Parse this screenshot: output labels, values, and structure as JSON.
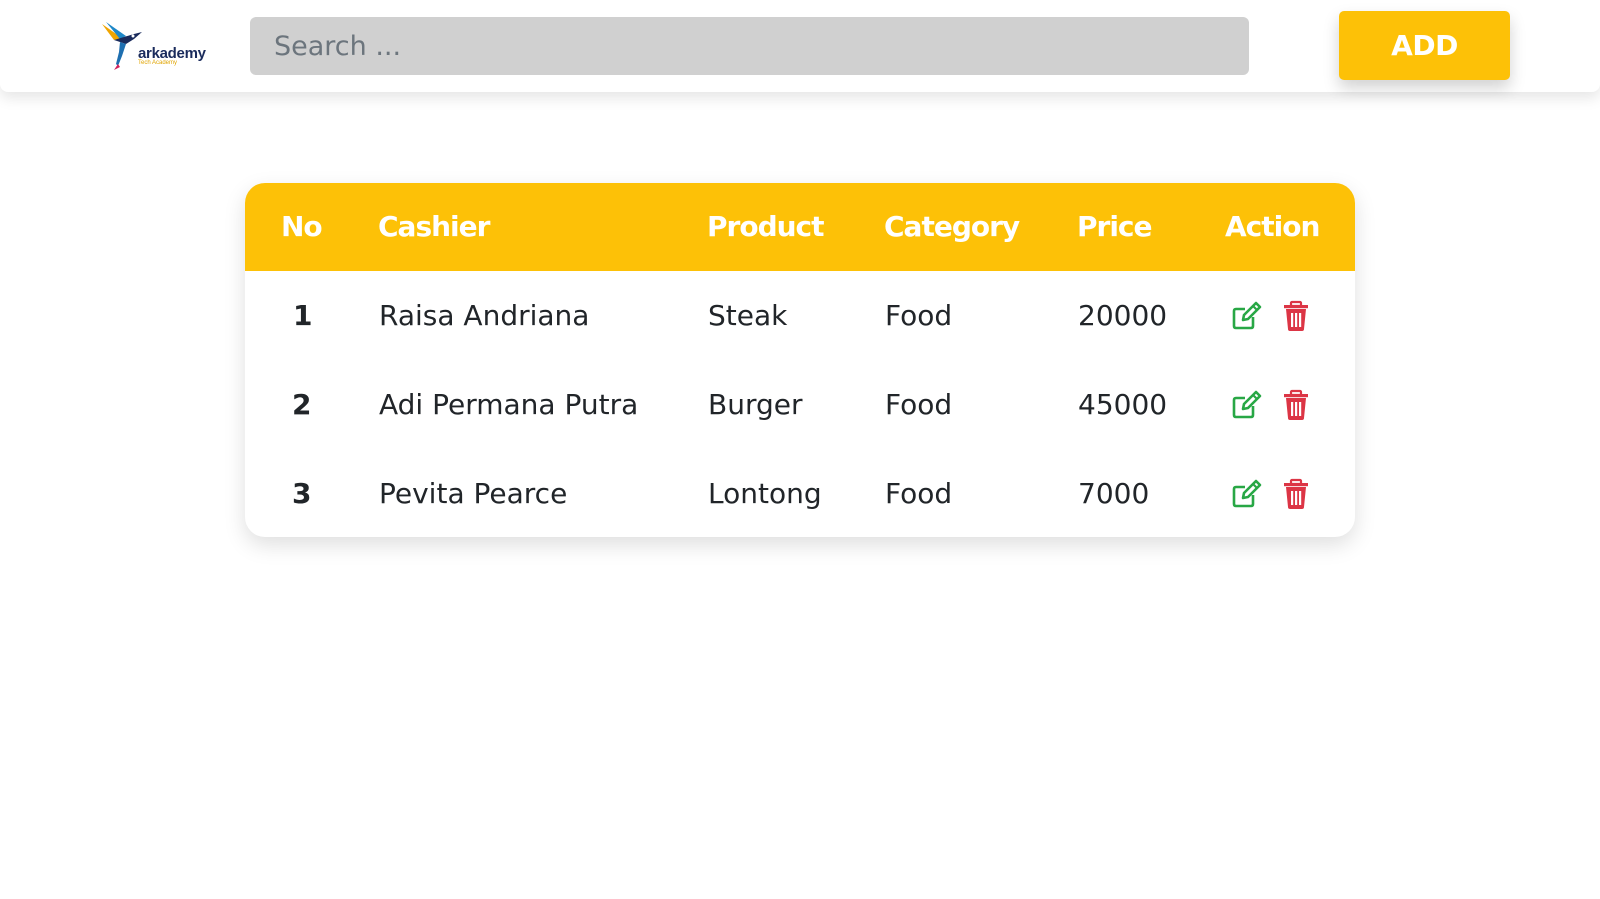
{
  "navbar": {
    "logo": {
      "word": "arkademy",
      "sub": "Tech Academy"
    },
    "search": {
      "placeholder": "Search ...",
      "value": ""
    },
    "add_label": "ADD"
  },
  "table": {
    "headers": [
      "No",
      "Cashier",
      "Product",
      "Category",
      "Price",
      "Action"
    ],
    "rows": [
      {
        "no": "1",
        "cashier": "Raisa Andriana",
        "product": "Steak",
        "category": "Food",
        "price": "20000"
      },
      {
        "no": "2",
        "cashier": "Adi Permana Putra",
        "product": "Burger",
        "category": "Food",
        "price": "45000"
      },
      {
        "no": "3",
        "cashier": "Pevita Pearce",
        "product": "Lontong",
        "category": "Food",
        "price": "7000"
      }
    ],
    "actions": {
      "edit_icon": "edit-icon",
      "delete_icon": "trash-icon"
    }
  },
  "colors": {
    "accent": "#fdc107",
    "edit": "#28a745",
    "delete": "#dc3545",
    "search_bg": "#d0d0d0"
  }
}
